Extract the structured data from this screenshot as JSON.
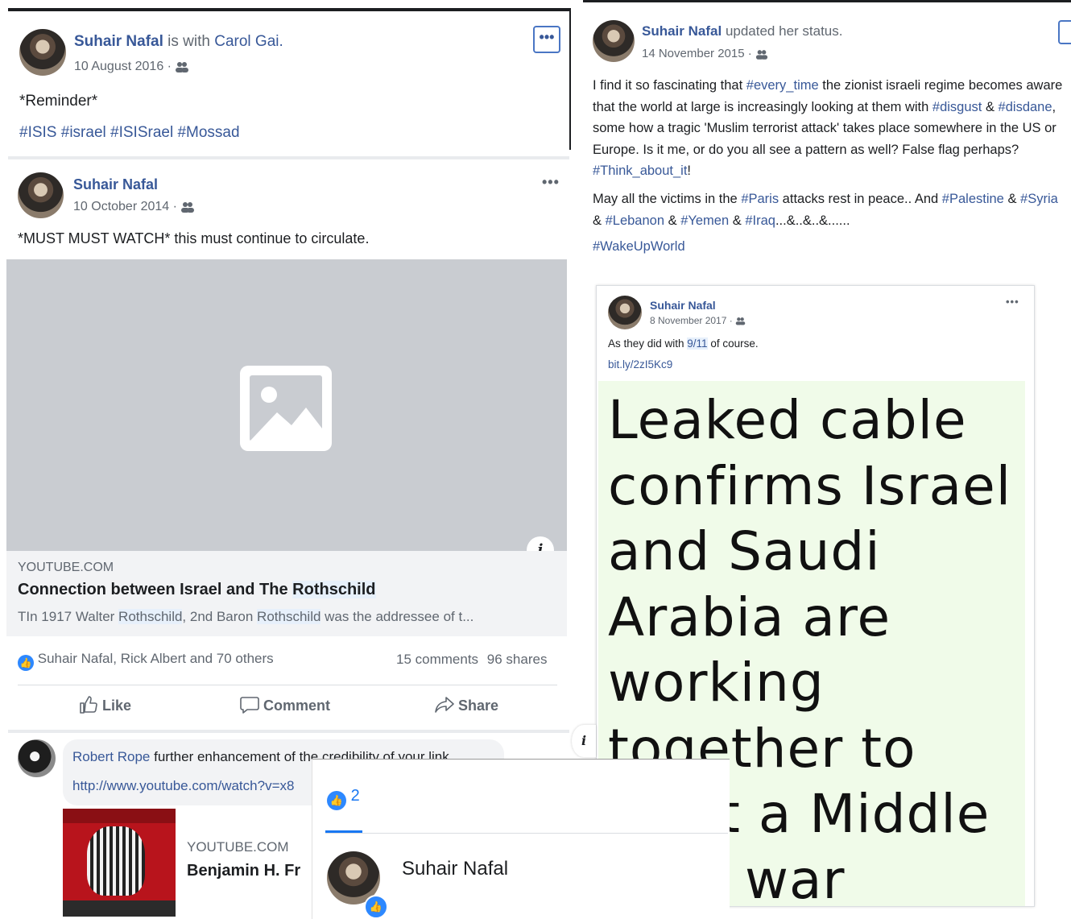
{
  "post1": {
    "author": "Suhair Nafal",
    "with_text": "is with",
    "with_name": "Carol Gai.",
    "date": "10 August 2016 ·",
    "body": "*Reminder*",
    "tags": [
      "#ISIS",
      "#israel",
      "#ISISrael",
      "#Mossad"
    ]
  },
  "post2": {
    "author": "Suhair Nafal",
    "date": "10 October 2014 ·",
    "body": "*MUST MUST WATCH* this must continue to circulate.",
    "link_source": "YOUTUBE.COM",
    "link_title_a": "Connection between Israel and The ",
    "link_title_b": "Rothschild",
    "link_desc_a": "TIn 1917 Walter ",
    "link_desc_b": "Rothschild",
    "link_desc_c": ", 2nd Baron ",
    "link_desc_d": "Rothschild",
    "link_desc_e": " was the addressee of t...",
    "reactions": "Suhair Nafal, Rick Albert and 70 others",
    "comments": "15 comments",
    "shares": "96 shares",
    "like": "Like",
    "comment": "Comment",
    "share": "Share"
  },
  "comment1": {
    "author": "Robert Rope",
    "text": "further enhancement of the credibility of your link",
    "url": "http://www.youtube.com/watch?v=x8",
    "link_source": "YOUTUBE.COM",
    "link_title": "Benjamin H. Fr"
  },
  "reaction_popup": {
    "count": "2",
    "person": "Suhair Nafal"
  },
  "post3": {
    "author": "Suhair Nafal",
    "action": "updated her status.",
    "date": "14 November 2015 ·",
    "p1_a": "I find it so fascinating that ",
    "p1_tag1": "#every_time",
    "p1_b": " the zionist israeli regime becomes aware that the world at large is increasingly looking at them with ",
    "p1_tag2": "#disgust",
    "p1_c": " & ",
    "p1_tag3": "#disdane",
    "p1_d": ", some how a tragic 'Muslim terrorist attack' takes place somewhere in the US or Europe. Is it me, or do you all see a pattern as well? False flag perhaps? ",
    "p1_tag4": "#Think_about_it",
    "p1_e": "!",
    "p2_a": "May all the victims in the ",
    "p2_tag1": "#Paris",
    "p2_b": " attacks rest in peace.. And ",
    "p2_tag2": "#Palestine",
    "p2_c": " & ",
    "p2_tag3": "#Syria",
    "p2_d": " & ",
    "p2_tag4": "#Lebanon",
    "p2_e": " & ",
    "p2_tag5": "#Yemen",
    "p2_f": " & ",
    "p2_tag6": "#Iraq",
    "p2_g": "...&..&..&......",
    "p3_tag": "#WakeUpWorld"
  },
  "post4": {
    "author": "Suhair Nafal",
    "date": "8 November 2017 ·",
    "body_a": "As they did with ",
    "body_link": "9/11",
    "body_b": " of course.",
    "short_url": "bit.ly/2zI5Kc9",
    "image_text_lines": [
      "Leaked cable",
      "confirms Israel",
      "and Saudi",
      "Arabia are",
      "working",
      "together to",
      "t a Middle",
      "war"
    ]
  },
  "colors": {
    "fb_blue": "#385898",
    "link_bg": "#f2f3f5",
    "placeholder_bg": "#c9ccd1",
    "card_green": "#f0fbe9"
  }
}
